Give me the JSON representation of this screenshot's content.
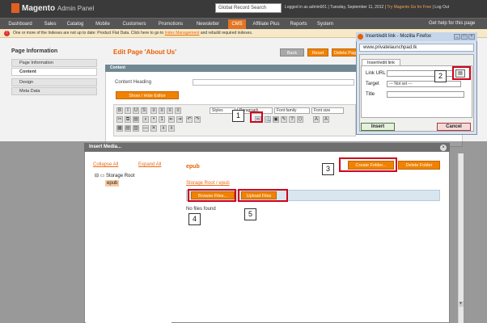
{
  "header": {
    "logo_text": "Magento",
    "logo_sub": "Admin Panel",
    "global_search_placeholder": "Global Record Search",
    "user_info": "Logged in as admin001  |  Tuesday, September 11, 2012  |",
    "go_link": "Try Magento Go for Free",
    "logout": "| Log Out"
  },
  "nav": {
    "items": [
      {
        "label": "Dashboard"
      },
      {
        "label": "Sales"
      },
      {
        "label": "Catalog"
      },
      {
        "label": "Mobile"
      },
      {
        "label": "Customers"
      },
      {
        "label": "Promotions"
      },
      {
        "label": "Newsletter"
      },
      {
        "label": "CMS"
      },
      {
        "label": "Affiliate Plus"
      },
      {
        "label": "Reports"
      },
      {
        "label": "System"
      }
    ],
    "active": "CMS",
    "help": "Get help for this page"
  },
  "notice": {
    "icon": "warning-icon",
    "text": "One or more of the Indexes are not up to date: Product Flat Data. Click here to go to",
    "link": "Index Management",
    "text_after": "and rebuild required indexes."
  },
  "sidebar": {
    "title": "Page Information",
    "tabs": [
      {
        "label": "Page Information"
      },
      {
        "label": "Content"
      },
      {
        "label": "Design"
      },
      {
        "label": "Meta Data"
      }
    ]
  },
  "main": {
    "page_title": "Edit Page 'About Us'",
    "buttons": {
      "back": "Back",
      "reset": "Reset",
      "delete": "Delete Page"
    },
    "content_legend": "Content",
    "content_heading_label": "Content Heading",
    "show_hide_label": "Show / Hide Editor",
    "toolbar": {
      "styles": "Styles",
      "paragraph": "Paragraph",
      "font_family": "Font family",
      "font_size": "Font size"
    }
  },
  "media_dialog": {
    "title": "Insert Media...",
    "collapse_all": "Collapse All",
    "expand_all": "Expand All",
    "tree_root": "Storage Root",
    "tree_child": "epub",
    "folder_title": "epub",
    "create_folder": "Create Folder...",
    "delete_folder": "Delete Folder",
    "breadcrumb_root": "Storage Root",
    "breadcrumb_sep": "/",
    "breadcrumb_child": "epub",
    "browse_files": "Browse Files...",
    "upload_files": "Upload Files",
    "no_files": "No files found",
    "close_icon": "close-icon"
  },
  "ff_popup": {
    "title": "Insert/edit link - Mozilla Firefox",
    "url": "www.privatelaunchpad.tk",
    "tab": "Insert/edit link",
    "link_url_label": "Link URL",
    "target_label": "Target",
    "target_value": "--- Not set ---",
    "title_label": "Title",
    "insert": "Insert",
    "cancel": "Cancel",
    "browse_icon": "browse-icon"
  },
  "callouts": [
    "1",
    "2",
    "3",
    "4",
    "5"
  ],
  "colors": {
    "accent": "#eb5e00",
    "callout": "#d0021b",
    "header_bg": "#3a3a3a"
  }
}
